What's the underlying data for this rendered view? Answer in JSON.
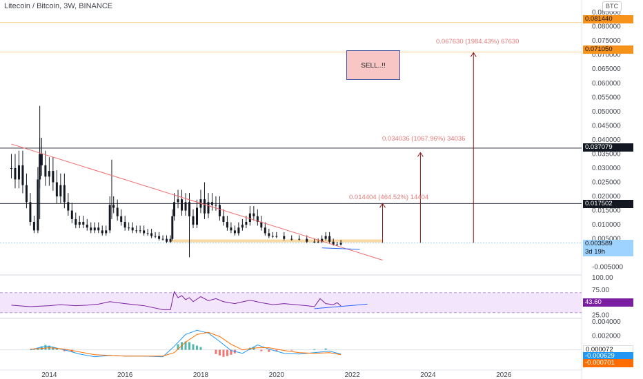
{
  "header": {
    "title": "Litecoin / Bitcoin, 3W, BINANCE",
    "currency_button": "BTC"
  },
  "chart_data": {
    "type": "candlestick",
    "title": "Litecoin / Bitcoin, 3W, BINANCE",
    "price_axis_labels": [
      "0.085000",
      "0.080000",
      "0.075000",
      "0.070000",
      "0.065000",
      "0.060000",
      "0.055000",
      "0.050000",
      "0.045000",
      "0.040000",
      "0.035000",
      "0.030000",
      "0.025000",
      "0.020000",
      "0.015000",
      "0.010000",
      "0.005000",
      "0.000000",
      "-0.005000"
    ],
    "price_ticks": [
      0.085,
      0.08,
      0.075,
      0.07,
      0.065,
      0.06,
      0.055,
      0.05,
      0.045,
      0.04,
      0.035,
      0.03,
      0.025,
      0.02,
      0.015,
      0.01,
      0.005,
      0,
      -0.005
    ],
    "price_range": [
      -0.0075,
      0.086
    ],
    "x_tick_labels": [
      "2014",
      "2016",
      "2018",
      "2020",
      "2022",
      "2024",
      "2026"
    ],
    "x_ticks": [
      2014,
      2016,
      2018,
      2020,
      2022,
      2024,
      2026
    ],
    "x_range": [
      2012.7,
      2028.0
    ],
    "price_path": [
      [
        2013.0,
        0.03
      ],
      [
        2013.1,
        0.026
      ],
      [
        2013.2,
        0.031
      ],
      [
        2013.3,
        0.024
      ],
      [
        2013.4,
        0.018
      ],
      [
        2013.5,
        0.011
      ],
      [
        2013.6,
        0.008
      ],
      [
        2013.7,
        0.026
      ],
      [
        2013.75,
        0.035
      ],
      [
        2013.8,
        0.031
      ],
      [
        2013.9,
        0.027
      ],
      [
        2014.0,
        0.029
      ],
      [
        2014.1,
        0.025
      ],
      [
        2014.2,
        0.02
      ],
      [
        2014.3,
        0.024
      ],
      [
        2014.4,
        0.018
      ],
      [
        2014.5,
        0.015
      ],
      [
        2014.6,
        0.012
      ],
      [
        2014.7,
        0.01
      ],
      [
        2014.8,
        0.011
      ],
      [
        2014.9,
        0.01
      ],
      [
        2015.0,
        0.009
      ],
      [
        2015.1,
        0.008
      ],
      [
        2015.2,
        0.009
      ],
      [
        2015.3,
        0.008
      ],
      [
        2015.4,
        0.007
      ],
      [
        2015.5,
        0.008
      ],
      [
        2015.6,
        0.017
      ],
      [
        2015.7,
        0.016
      ],
      [
        2015.8,
        0.013
      ],
      [
        2015.9,
        0.011
      ],
      [
        2016.0,
        0.009
      ],
      [
        2016.1,
        0.009
      ],
      [
        2016.2,
        0.008
      ],
      [
        2016.3,
        0.008
      ],
      [
        2016.4,
        0.008
      ],
      [
        2016.5,
        0.007
      ],
      [
        2016.6,
        0.007
      ],
      [
        2016.7,
        0.006
      ],
      [
        2016.8,
        0.006
      ],
      [
        2016.9,
        0.005
      ],
      [
        2017.0,
        0.005
      ],
      [
        2017.1,
        0.004
      ],
      [
        2017.2,
        0.005
      ],
      [
        2017.25,
        0.013
      ],
      [
        2017.3,
        0.018
      ],
      [
        2017.4,
        0.019
      ],
      [
        2017.5,
        0.015
      ],
      [
        2017.6,
        0.018
      ],
      [
        2017.7,
        0.013
      ],
      [
        2017.8,
        0.01
      ],
      [
        2017.9,
        0.016
      ],
      [
        2018.0,
        0.019
      ],
      [
        2018.1,
        0.014
      ],
      [
        2018.2,
        0.018
      ],
      [
        2018.3,
        0.017
      ],
      [
        2018.4,
        0.017
      ],
      [
        2018.5,
        0.013
      ],
      [
        2018.6,
        0.011
      ],
      [
        2018.7,
        0.009
      ],
      [
        2018.8,
        0.008
      ],
      [
        2018.9,
        0.007
      ],
      [
        2019.0,
        0.009
      ],
      [
        2019.1,
        0.01
      ],
      [
        2019.2,
        0.011
      ],
      [
        2019.3,
        0.014
      ],
      [
        2019.4,
        0.013
      ],
      [
        2019.5,
        0.011
      ],
      [
        2019.6,
        0.009
      ],
      [
        2019.7,
        0.007
      ],
      [
        2019.8,
        0.006
      ],
      [
        2019.9,
        0.006
      ],
      [
        2020.0,
        0.006
      ],
      [
        2020.2,
        0.005
      ],
      [
        2020.4,
        0.005
      ],
      [
        2020.6,
        0.005
      ],
      [
        2020.8,
        0.004
      ],
      [
        2021.0,
        0.004
      ],
      [
        2021.1,
        0.004
      ],
      [
        2021.2,
        0.005
      ],
      [
        2021.3,
        0.006
      ],
      [
        2021.4,
        0.004
      ],
      [
        2021.5,
        0.003
      ],
      [
        2021.6,
        0.003
      ],
      [
        2021.7,
        0.0036
      ]
    ],
    "rsi_axis_labels": [
      "100.00",
      "75.00",
      "50.00",
      "25.00"
    ],
    "rsi_ticks": [
      100,
      75,
      50,
      25
    ],
    "rsi_range": [
      20,
      104
    ],
    "rsi_band": [
      30,
      70
    ],
    "rsi_path": [
      [
        2013.0,
        45
      ],
      [
        2013.5,
        42
      ],
      [
        2014.0,
        44
      ],
      [
        2014.3,
        46
      ],
      [
        2014.7,
        44
      ],
      [
        2015.0,
        45
      ],
      [
        2015.3,
        47
      ],
      [
        2015.6,
        52
      ],
      [
        2016.0,
        48
      ],
      [
        2016.5,
        44
      ],
      [
        2017.0,
        36
      ],
      [
        2017.2,
        36
      ],
      [
        2017.3,
        72
      ],
      [
        2017.4,
        60
      ],
      [
        2017.5,
        64
      ],
      [
        2017.6,
        56
      ],
      [
        2017.7,
        60
      ],
      [
        2017.8,
        52
      ],
      [
        2018.0,
        62
      ],
      [
        2018.2,
        54
      ],
      [
        2018.4,
        58
      ],
      [
        2018.6,
        52
      ],
      [
        2018.9,
        48
      ],
      [
        2019.0,
        50
      ],
      [
        2019.3,
        55
      ],
      [
        2019.6,
        50
      ],
      [
        2019.9,
        46
      ],
      [
        2020.2,
        48
      ],
      [
        2020.5,
        46
      ],
      [
        2020.8,
        44
      ],
      [
        2021.0,
        42
      ],
      [
        2021.15,
        58
      ],
      [
        2021.3,
        48
      ],
      [
        2021.5,
        46
      ],
      [
        2021.6,
        50
      ],
      [
        2021.7,
        43.6
      ]
    ],
    "rsi_trend": [
      [
        2021.0,
        38
      ],
      [
        2022.4,
        47
      ]
    ],
    "macd_axis_labels": [
      "0.004000",
      "0.002000",
      "0.000000",
      "-0.002000"
    ],
    "macd_ticks": [
      0.004,
      0.002,
      0,
      -0.002
    ],
    "macd_range": [
      -0.0024,
      0.0044
    ],
    "macd_line": [
      [
        2013.5,
        0.0
      ],
      [
        2013.8,
        0.0004
      ],
      [
        2014.0,
        0.0005
      ],
      [
        2014.4,
        0.0
      ],
      [
        2014.8,
        -0.0006
      ],
      [
        2015.2,
        -0.001
      ],
      [
        2015.6,
        -0.0008
      ],
      [
        2016.0,
        -0.0009
      ],
      [
        2016.5,
        -0.0009
      ],
      [
        2017.0,
        -0.001
      ],
      [
        2017.3,
        0.0005
      ],
      [
        2017.6,
        0.0022
      ],
      [
        2017.9,
        0.0028
      ],
      [
        2018.2,
        0.0024
      ],
      [
        2018.5,
        0.0012
      ],
      [
        2018.8,
        -0.0001
      ],
      [
        2019.1,
        -0.0005
      ],
      [
        2019.5,
        0.0007
      ],
      [
        2019.8,
        0.0001
      ],
      [
        2020.2,
        -0.0005
      ],
      [
        2020.6,
        -0.0006
      ],
      [
        2021.0,
        -0.0004
      ],
      [
        2021.4,
        -0.0002
      ],
      [
        2021.7,
        -0.0006
      ]
    ],
    "signal_line": [
      [
        2013.5,
        0.0001
      ],
      [
        2013.8,
        0.0002
      ],
      [
        2014.0,
        0.0003
      ],
      [
        2014.4,
        0.0001
      ],
      [
        2014.8,
        -0.0003
      ],
      [
        2015.2,
        -0.0007
      ],
      [
        2015.6,
        -0.0008
      ],
      [
        2016.0,
        -0.0009
      ],
      [
        2016.5,
        -0.0009
      ],
      [
        2017.0,
        -0.0009
      ],
      [
        2017.3,
        -0.0004
      ],
      [
        2017.6,
        0.0011
      ],
      [
        2017.9,
        0.0022
      ],
      [
        2018.2,
        0.0025
      ],
      [
        2018.5,
        0.0019
      ],
      [
        2018.8,
        0.0008
      ],
      [
        2019.1,
        0.0
      ],
      [
        2019.5,
        0.0003
      ],
      [
        2019.8,
        0.0003
      ],
      [
        2020.2,
        -0.0001
      ],
      [
        2020.6,
        -0.0004
      ],
      [
        2021.0,
        -0.0005
      ],
      [
        2021.4,
        -0.0004
      ],
      [
        2021.7,
        -0.0007
      ]
    ],
    "macd_hist": [
      [
        2013.6,
        0.0001
      ],
      [
        2013.7,
        0.0003
      ],
      [
        2013.8,
        0.0005
      ],
      [
        2013.9,
        0.0007
      ],
      [
        2014.0,
        0.0006
      ],
      [
        2014.1,
        0.0004
      ],
      [
        2014.2,
        0.0002
      ],
      [
        2014.4,
        -0.0002
      ],
      [
        2014.6,
        -0.0003
      ],
      [
        2017.4,
        0.0008
      ],
      [
        2017.5,
        0.0011
      ],
      [
        2017.6,
        0.0012
      ],
      [
        2017.7,
        0.0011
      ],
      [
        2017.8,
        0.0008
      ],
      [
        2017.9,
        0.0006
      ],
      [
        2018.0,
        0.0004
      ],
      [
        2018.4,
        -0.0006
      ],
      [
        2018.5,
        -0.0008
      ],
      [
        2018.6,
        -0.001
      ],
      [
        2018.7,
        -0.0009
      ],
      [
        2018.8,
        -0.0007
      ],
      [
        2018.9,
        -0.0005
      ],
      [
        2019.3,
        0.0003
      ],
      [
        2019.4,
        0.0004
      ],
      [
        2019.6,
        -0.0002
      ],
      [
        2019.8,
        -0.0003
      ],
      [
        2020.0,
        -0.0002
      ],
      [
        2020.4,
        -0.0001
      ],
      [
        2021.0,
        0.0001
      ],
      [
        2021.3,
        0.0002
      ]
    ],
    "trendline_down": [
      [
        2013.0,
        0.0385
      ],
      [
        2022.8,
        -0.0025
      ]
    ],
    "support_band": [
      [
        2017.2,
        0.0043
      ],
      [
        2022.8,
        0.0043
      ]
    ],
    "support_short": [
      [
        2021.2,
        0.0018
      ],
      [
        2022.2,
        0.0013
      ]
    ],
    "horizontal_levels": [
      {
        "price": 0.08144,
        "label": "0.081440",
        "style": "orange"
      },
      {
        "price": 0.07105,
        "label": "0.071050",
        "style": "orange"
      },
      {
        "price": 0.037079,
        "label": "0.037079",
        "style": "black"
      },
      {
        "price": 0.017502,
        "label": "0.017502",
        "style": "black"
      }
    ],
    "target_arrows": [
      {
        "x": 2022.8,
        "from": 0.0036,
        "to": 0.0175,
        "text": "0.014404 (464.52%) 14404",
        "text_x": 2021.3
      },
      {
        "x": 2023.8,
        "from": 0.0036,
        "to": 0.0355,
        "text": "0.034036 (1067.96%) 34036",
        "text_x": 2021.45
      },
      {
        "x": 2025.2,
        "from": 0.0036,
        "to": 0.0708,
        "text": "0.067630 (1984.43%) 67630",
        "text_x": 2023.1
      }
    ],
    "last_price": "0.003589",
    "countdown": "3d 19h",
    "rsi_value": "43.60",
    "macd_values": [
      "0.000072",
      "-0.000629",
      "-0.000701"
    ]
  },
  "annotations": {
    "sell_label": "SELL..!!"
  },
  "colors": {
    "candle": "#131722",
    "trendline": "#f26a6a",
    "orange_level": "#f7c06a",
    "support": "#f7c77a",
    "rsi_line": "#7b1fa2",
    "rsi_band_fill": "#f3e5fb",
    "macd_line": "#2196f3",
    "signal_line": "#ff6d00",
    "hist_up": "#26a69a",
    "hist_down": "#ef5350",
    "arrow": "#8b1a1a",
    "blue_trend": "#2962ff"
  }
}
